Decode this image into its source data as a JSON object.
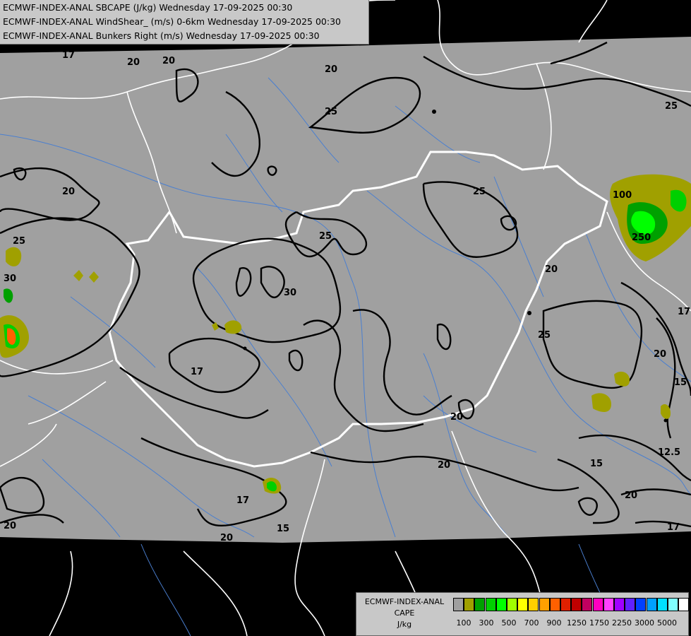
{
  "header": {
    "line1": "ECMWF-INDEX-ANAL SBCAPE (J/kg) Wednesday 17-09-2025 00:30",
    "line2": "ECMWF-INDEX-ANAL WindShear_ (m/s) 0-6km Wednesday 17-09-2025 00:30",
    "line3": "ECMWF-INDEX-ANAL Bunkers Right (m/s) Wednesday 17-09-2025 00:30"
  },
  "legend": {
    "title1": "ECMWF-INDEX-ANAL",
    "title2": "CAPE",
    "title3": "J/kg",
    "colors": [
      "#a0a0a0",
      "#a0a000",
      "#00a000",
      "#00d000",
      "#00ff00",
      "#a0ff00",
      "#ffff00",
      "#ffd000",
      "#ffa000",
      "#ff6000",
      "#e02000",
      "#c00000",
      "#c00060",
      "#ff00c0",
      "#ff40ff",
      "#a000ff",
      "#6020ff",
      "#0040ff",
      "#00a0ff",
      "#00e0ff",
      "#80ffff",
      "#ffffff"
    ],
    "ticks": [
      "100",
      "300",
      "500",
      "700",
      "900",
      "1250",
      "1750",
      "2250",
      "3000",
      "5000"
    ]
  },
  "contour_labels": [
    "17",
    "20",
    "20",
    "20",
    "25",
    "25",
    "25",
    "20",
    "25",
    "30",
    "25",
    "30",
    "17",
    "20",
    "20",
    "25",
    "20",
    "17",
    "15",
    "12.5",
    "15",
    "20",
    "17",
    "20",
    "17",
    "15",
    "20",
    "100",
    "250",
    "20"
  ],
  "colors": {
    "map_fill": "#a0a0a0",
    "outside": "#000000",
    "border": "#ffffff",
    "river": "#4a7fd0",
    "contour": "#000000"
  }
}
